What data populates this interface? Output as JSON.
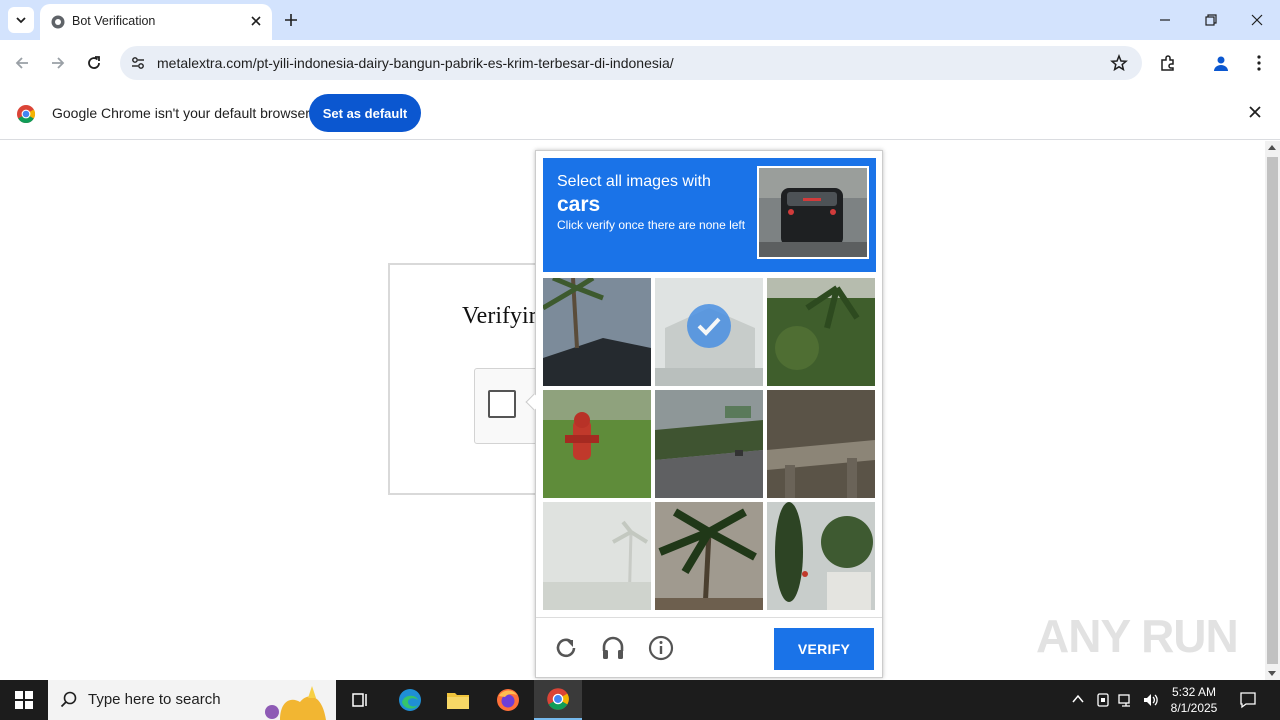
{
  "browser": {
    "tab_title": "Bot Verification",
    "url": "metalextra.com/pt-yili-indonesia-dairy-bangun-pabrik-es-krim-terbesar-di-indonesia/"
  },
  "infobar": {
    "message": "Google Chrome isn't your default browser",
    "button_label": "Set as default"
  },
  "page": {
    "heading": "Verifyir"
  },
  "captcha": {
    "line1": "Select all images with",
    "target": "cars",
    "line3": "Click verify once there are none left",
    "verify_label": "VERIFY",
    "accent": "#1a73e8",
    "tiles": [
      {
        "subject": "palm tree and roof",
        "selected": false
      },
      {
        "subject": "faded house",
        "selected": true
      },
      {
        "subject": "palm plants",
        "selected": false
      },
      {
        "subject": "fire hydrant",
        "selected": false
      },
      {
        "subject": "road with trees",
        "selected": false
      },
      {
        "subject": "bridge underside",
        "selected": false
      },
      {
        "subject": "faded palm trees",
        "selected": false
      },
      {
        "subject": "palm tree",
        "selected": false
      },
      {
        "subject": "trees and building",
        "selected": false
      }
    ],
    "footer_icons": [
      "reload-icon",
      "audio-icon",
      "info-icon"
    ]
  },
  "watermark": "ANY RUN",
  "taskbar": {
    "search_placeholder": "Type here to search",
    "time": "5:32 AM",
    "date": "8/1/2025"
  }
}
